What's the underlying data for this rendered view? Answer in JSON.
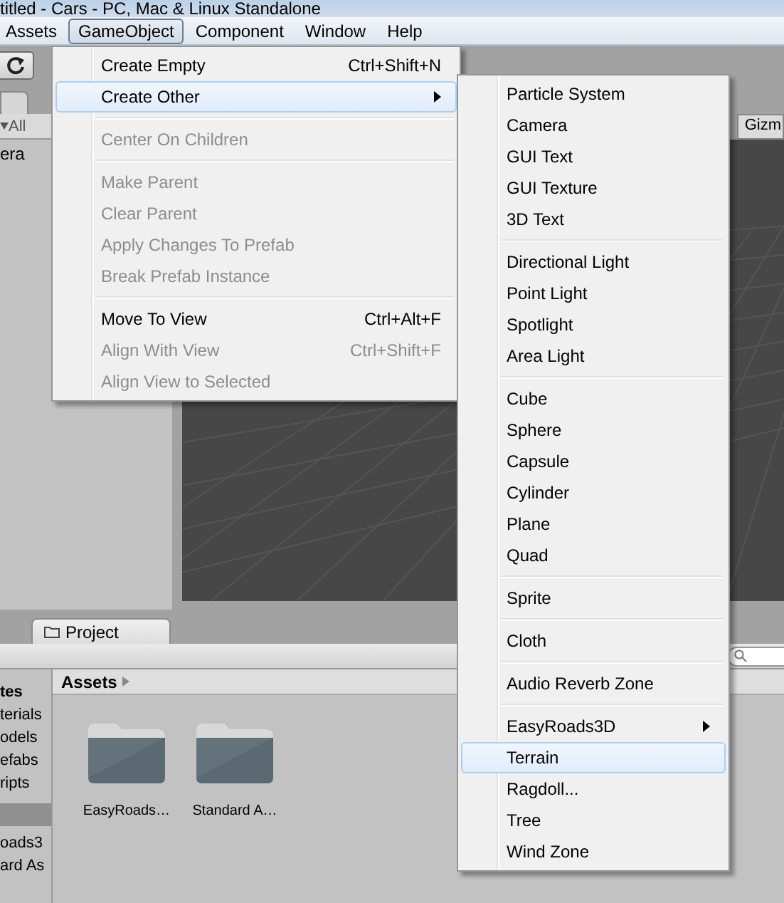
{
  "window": {
    "title": "titled - Cars - PC, Mac & Linux Standalone"
  },
  "menu_bar": [
    {
      "label": "Assets",
      "selected": false
    },
    {
      "label": "GameObject",
      "selected": true
    },
    {
      "label": "Component",
      "selected": false
    },
    {
      "label": "Window",
      "selected": false
    },
    {
      "label": "Help",
      "selected": false
    }
  ],
  "gameobject_menu": {
    "sections": [
      [
        {
          "label": "Create Empty",
          "shortcut": "Ctrl+Shift+N",
          "disabled": false,
          "submenu": false,
          "selected": false
        },
        {
          "label": "Create Other",
          "disabled": false,
          "submenu": true,
          "selected": true
        }
      ],
      [
        {
          "label": "Center On Children",
          "disabled": true,
          "submenu": false,
          "selected": false
        }
      ],
      [
        {
          "label": "Make Parent",
          "disabled": true,
          "submenu": false,
          "selected": false
        },
        {
          "label": "Clear Parent",
          "disabled": true,
          "submenu": false,
          "selected": false
        },
        {
          "label": "Apply Changes To Prefab",
          "disabled": true,
          "submenu": false,
          "selected": false
        },
        {
          "label": "Break Prefab Instance",
          "disabled": true,
          "submenu": false,
          "selected": false
        }
      ],
      [
        {
          "label": "Move To View",
          "shortcut": "Ctrl+Alt+F",
          "disabled": false,
          "submenu": false,
          "selected": false
        },
        {
          "label": "Align With View",
          "shortcut": "Ctrl+Shift+F",
          "disabled": true,
          "submenu": false,
          "selected": false
        },
        {
          "label": "Align View to Selected",
          "disabled": true,
          "submenu": false,
          "selected": false
        }
      ]
    ]
  },
  "create_other_menu": {
    "sections": [
      [
        {
          "label": "Particle System",
          "submenu": false,
          "selected": false
        },
        {
          "label": "Camera",
          "submenu": false,
          "selected": false
        },
        {
          "label": "GUI Text",
          "submenu": false,
          "selected": false
        },
        {
          "label": "GUI Texture",
          "submenu": false,
          "selected": false
        },
        {
          "label": "3D Text",
          "submenu": false,
          "selected": false
        }
      ],
      [
        {
          "label": "Directional Light",
          "submenu": false,
          "selected": false
        },
        {
          "label": "Point Light",
          "submenu": false,
          "selected": false
        },
        {
          "label": "Spotlight",
          "submenu": false,
          "selected": false
        },
        {
          "label": "Area Light",
          "submenu": false,
          "selected": false
        }
      ],
      [
        {
          "label": "Cube",
          "submenu": false,
          "selected": false
        },
        {
          "label": "Sphere",
          "submenu": false,
          "selected": false
        },
        {
          "label": "Capsule",
          "submenu": false,
          "selected": false
        },
        {
          "label": "Cylinder",
          "submenu": false,
          "selected": false
        },
        {
          "label": "Plane",
          "submenu": false,
          "selected": false
        },
        {
          "label": "Quad",
          "submenu": false,
          "selected": false
        }
      ],
      [
        {
          "label": "Sprite",
          "submenu": false,
          "selected": false
        }
      ],
      [
        {
          "label": "Cloth",
          "submenu": false,
          "selected": false
        }
      ],
      [
        {
          "label": "Audio Reverb Zone",
          "submenu": false,
          "selected": false
        }
      ],
      [
        {
          "label": "EasyRoads3D",
          "submenu": true,
          "selected": false
        },
        {
          "label": "Terrain",
          "submenu": false,
          "selected": true
        },
        {
          "label": "Ragdoll...",
          "submenu": false,
          "selected": false
        },
        {
          "label": "Tree",
          "submenu": false,
          "selected": false
        },
        {
          "label": "Wind Zone",
          "submenu": false,
          "selected": false
        }
      ]
    ]
  },
  "hierarchy": {
    "filter": "All",
    "items": [
      "era"
    ]
  },
  "scene_view": {
    "gizmos": "Gizm"
  },
  "project": {
    "tab": "Project",
    "favorites_heading": "tes",
    "favorites": [
      "terials",
      "odels",
      "efabs",
      "ripts"
    ],
    "assets_tree": [
      "oads3",
      "ard As"
    ],
    "breadcrumb": "Assets",
    "folders": [
      "EasyRoads…",
      "Standard A…"
    ]
  }
}
